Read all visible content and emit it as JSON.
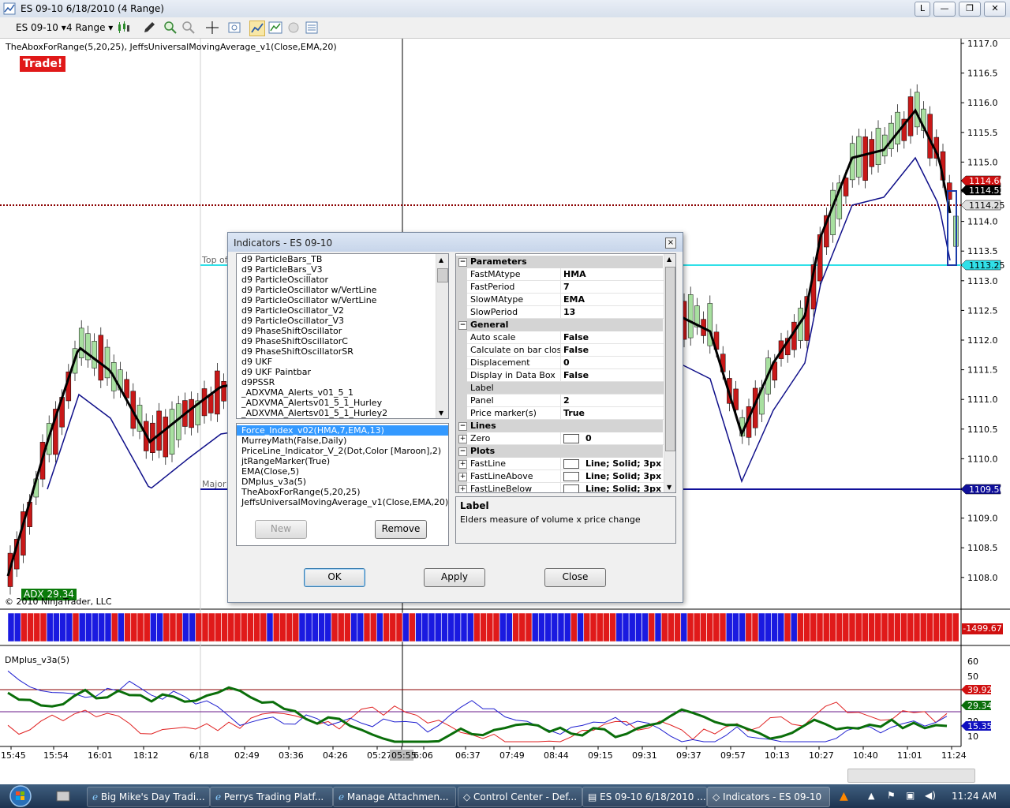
{
  "window": {
    "title": "ES 09-10  6/18/2010 (4 Range)",
    "buttons": [
      "L",
      "—",
      "❐",
      "✕"
    ]
  },
  "toolbar": {
    "instrument": "ES 09-10",
    "period": "4 Range"
  },
  "chart": {
    "indicator_caption": "TheAboxForRange(5,20,25), JeffsUniversalMovingAverage_v1(Close,EMA,20)",
    "trade_label": "Trade!",
    "adx_label": "ADX 29.34",
    "copyright": "© 2010 NinjaTrader, LLC",
    "top_label": "Top of",
    "major_label": "Major",
    "lower_panel_caption": "DMplus_v3a(5)",
    "price_axis": [
      "1117.0",
      "1116.5",
      "1116.0",
      "1115.5",
      "1115.0",
      "1114.5",
      "1114.0",
      "1113.5",
      "1113.0",
      "1112.5",
      "1112.0",
      "1111.5",
      "1111.0",
      "1110.5",
      "1110.0",
      "1109.5",
      "1109.0",
      "1108.5",
      "1108.0"
    ],
    "price_markers": [
      {
        "text": "1114.66",
        "color": "#d01010"
      },
      {
        "text": "1114.52",
        "color": "#000000"
      },
      {
        "text": "1114.25",
        "color": "#e0e0e0"
      },
      {
        "text": "1113.25",
        "color": "#30e0e8"
      },
      {
        "text": "1109.50",
        "color": "#10109a"
      }
    ],
    "ribbon_value": "-1499.67",
    "osc_axis": [
      "60",
      "50",
      "40",
      "30",
      "20",
      "10"
    ],
    "osc_markers": [
      {
        "text": "39.92",
        "color": "#d01010"
      },
      {
        "text": "29.34",
        "color": "#0a6e0a"
      },
      {
        "text": "15.35",
        "color": "#1010c0"
      }
    ],
    "time_axis": [
      "15:45",
      "15:54",
      "16:01",
      "18:12",
      "6/18",
      "02:49",
      "03:36",
      "04:26",
      "05:27",
      "05:55",
      "6:06",
      "06:37",
      "07:49",
      "08:44",
      "09:15",
      "09:31",
      "09:37",
      "09:57",
      "10:13",
      "10:27",
      "10:40",
      "11:01",
      "11:24"
    ],
    "cursor_time": "05:55"
  },
  "dialog": {
    "title": "Indicators - ES 09-10",
    "available": [
      "d9 ParticleBars_TB",
      "d9 ParticleBars_V3",
      "d9 ParticleOscillator",
      "d9 ParticleOscillator w/VertLine",
      "d9 ParticleOscillator w/VertLine",
      "d9 ParticleOscillator_V2",
      "d9 ParticleOscillator_V3",
      "d9 PhaseShiftOscillator",
      "d9 PhaseShiftOscillatorC",
      "d9 PhaseShiftOscillatorSR",
      "d9 UKF",
      "d9 UKF Paintbar",
      "d9PSSR",
      "_ADXVMA_Alerts_v01_5_1",
      "_ADXVMA_Alertsv01_5_1_Hurley",
      "_ADXVMA_Alertsv01_5_1_Hurley2"
    ],
    "configured": [
      "Force_Index_v02(HMA,7,EMA,13)",
      "MurreyMath(False,Daily)",
      "PriceLine_Indicator_V_2(Dot,Color [Maroon],2)",
      "jtRangeMarker(True)",
      "EMA(Close,5)",
      "DMplus_v3a(5)",
      "TheAboxForRange(5,20,25)",
      "JeffsUniversalMovingAverage_v1(Close,EMA,20)"
    ],
    "new_label": "New",
    "remove_label": "Remove",
    "ok_label": "OK",
    "apply_label": "Apply",
    "close_label": "Close",
    "categories": {
      "parameters": "Parameters",
      "general": "General",
      "lines": "Lines",
      "plots": "Plots"
    },
    "parameters": [
      {
        "name": "FastMAtype",
        "value": "HMA"
      },
      {
        "name": "FastPeriod",
        "value": "7"
      },
      {
        "name": "SlowMAtype",
        "value": "EMA"
      },
      {
        "name": "SlowPeriod",
        "value": "13"
      }
    ],
    "general": [
      {
        "name": "Auto scale",
        "value": "False"
      },
      {
        "name": "Calculate on bar close",
        "value": "False"
      },
      {
        "name": "Displacement",
        "value": "0"
      },
      {
        "name": "Display in Data Box",
        "value": "False"
      },
      {
        "name": "Label",
        "value": ""
      },
      {
        "name": "Panel",
        "value": "2"
      },
      {
        "name": "Price marker(s)",
        "value": "True"
      }
    ],
    "lines": [
      {
        "name": "Zero",
        "value": "0"
      }
    ],
    "plots": [
      {
        "name": "FastLine",
        "value": "Line; Solid; 3px"
      },
      {
        "name": "FastLineAbove",
        "value": "Line; Solid; 3px"
      },
      {
        "name": "FastLineBelow",
        "value": "Line; Solid; 3px"
      }
    ],
    "help_title": "Label",
    "help_text": "Elders measure of volume x price change"
  },
  "taskbar": {
    "tasks": [
      "Big Mike's Day Tradi...",
      "Perrys Trading Platf...",
      "Manage Attachmen...",
      "Control Center - Def...",
      "ES 09-10  6/18/2010 ...",
      "Indicators - ES 09-10"
    ],
    "clock": "11:24 AM"
  }
}
